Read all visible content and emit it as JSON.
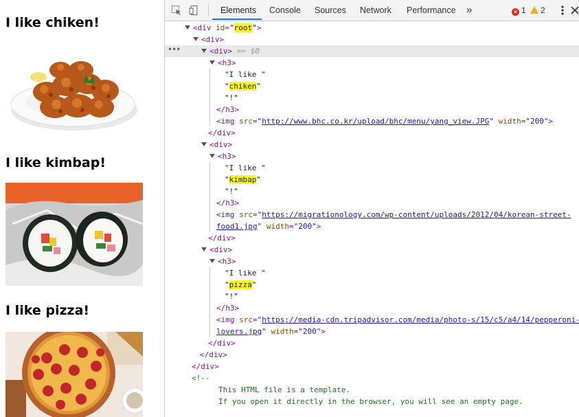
{
  "page": {
    "items": [
      {
        "pre": "I like ",
        "food": "chiken",
        "post": "!",
        "src": "http://www.bhc.co.kr/upload/bhc/menu/yang_view.JPG",
        "width": "200"
      },
      {
        "pre": "I like ",
        "food": "kimbap",
        "post": "!",
        "src": "https://migrationology.com/wp-content/uploads/2012/04/korean-street-food1.jpg",
        "width": "200"
      },
      {
        "pre": "I like ",
        "food": "pizza",
        "post": "!",
        "src": "https://media-cdn.tripadvisor.com/media/photo-s/15/c5/a4/14/pepperoni-lovers.jpg",
        "width": "200"
      }
    ]
  },
  "devtools": {
    "tabs": [
      "Elements",
      "Console",
      "Sources",
      "Network",
      "Performance"
    ],
    "active_tab": "Elements",
    "more_tabs": "»",
    "error_count": "1",
    "warning_count": "2",
    "dom": {
      "root_open": "<div",
      "root_attr": "id",
      "root_id": "root",
      "div_open": "<div>",
      "div_close": "</div>",
      "sel_marker": "== $0",
      "h3_open": "<h3>",
      "h3_close": "</h3>",
      "img_open": "<img",
      "src_attr": "src",
      "width_attr": "width",
      "quote": "\"",
      "close_tag": ">",
      "comment_open": "<!--",
      "comment_line1": "This HTML file is a template.",
      "comment_line2": "If you open it directly in the browser, you will see an empty page.",
      "img1_src_part1": "http://www.bhc.co.kr/upload/bhc/menu/yang_view.JPG",
      "img2_src_part1": "https://migrationology.com/wp-content/uploads/2012/04/korean-street-",
      "img2_src_part2": "food1.jpg",
      "img3_src_part1": "https://media-cdn.tripadvisor.com/media/photo-s/15/c5/a4/14/pepperoni-",
      "img3_src_part2": "lovers.jpg",
      "ellipsis": "•••"
    }
  },
  "colors": {
    "accent": "#1a73e8",
    "tag": "#881280",
    "attr_name": "#994500",
    "attr_value": "#1a1aa6",
    "highlight": "#fbf724",
    "comment": "#236e25"
  }
}
